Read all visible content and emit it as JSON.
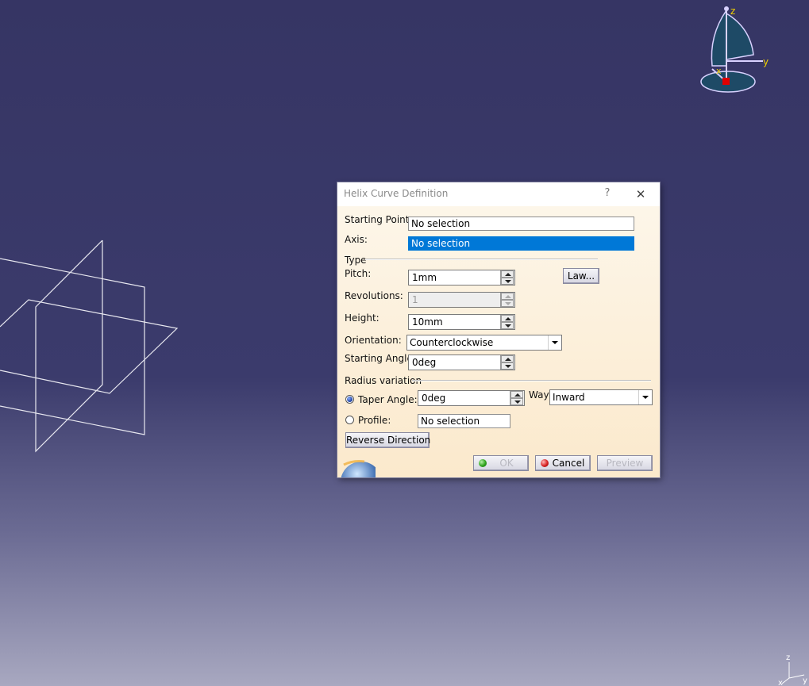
{
  "dialog": {
    "title": "Helix Curve Definition",
    "help_label": "?",
    "close_label": "✕"
  },
  "fields": {
    "starting_point": {
      "label": "Starting Point:",
      "value": "No selection"
    },
    "axis": {
      "label": "Axis:",
      "value": "No selection"
    },
    "type_group": "Type",
    "pitch": {
      "label": "Pitch:",
      "value": "1mm",
      "law_button": "Law..."
    },
    "revolutions": {
      "label": "Revolutions:",
      "value": "1"
    },
    "height": {
      "label": "Height:",
      "value": "10mm"
    },
    "orientation": {
      "label": "Orientation:",
      "value": "Counterclockwise"
    },
    "starting_angle": {
      "label": "Starting Angle:",
      "value": "0deg"
    },
    "radius_group": "Radius variation",
    "taper_angle": {
      "label": "Taper Angle:",
      "value": "0deg"
    },
    "way": {
      "label": "Way:",
      "value": "Inward"
    },
    "profile": {
      "label": "Profile:",
      "value": "No selection"
    }
  },
  "buttons": {
    "reverse_direction": "Reverse Direction",
    "ok": "OK",
    "cancel": "Cancel",
    "preview": "Preview"
  },
  "compass": {
    "z": "z",
    "y": "y",
    "x": "x"
  },
  "mini_axes": {
    "z": "z",
    "x": "x",
    "y": "y"
  },
  "colors": {
    "selection_blue": "#0078d7",
    "compass_fill": "#1e4a66",
    "compass_stroke": "#d9d2ff",
    "compass_axis_label": "#f0d000"
  }
}
